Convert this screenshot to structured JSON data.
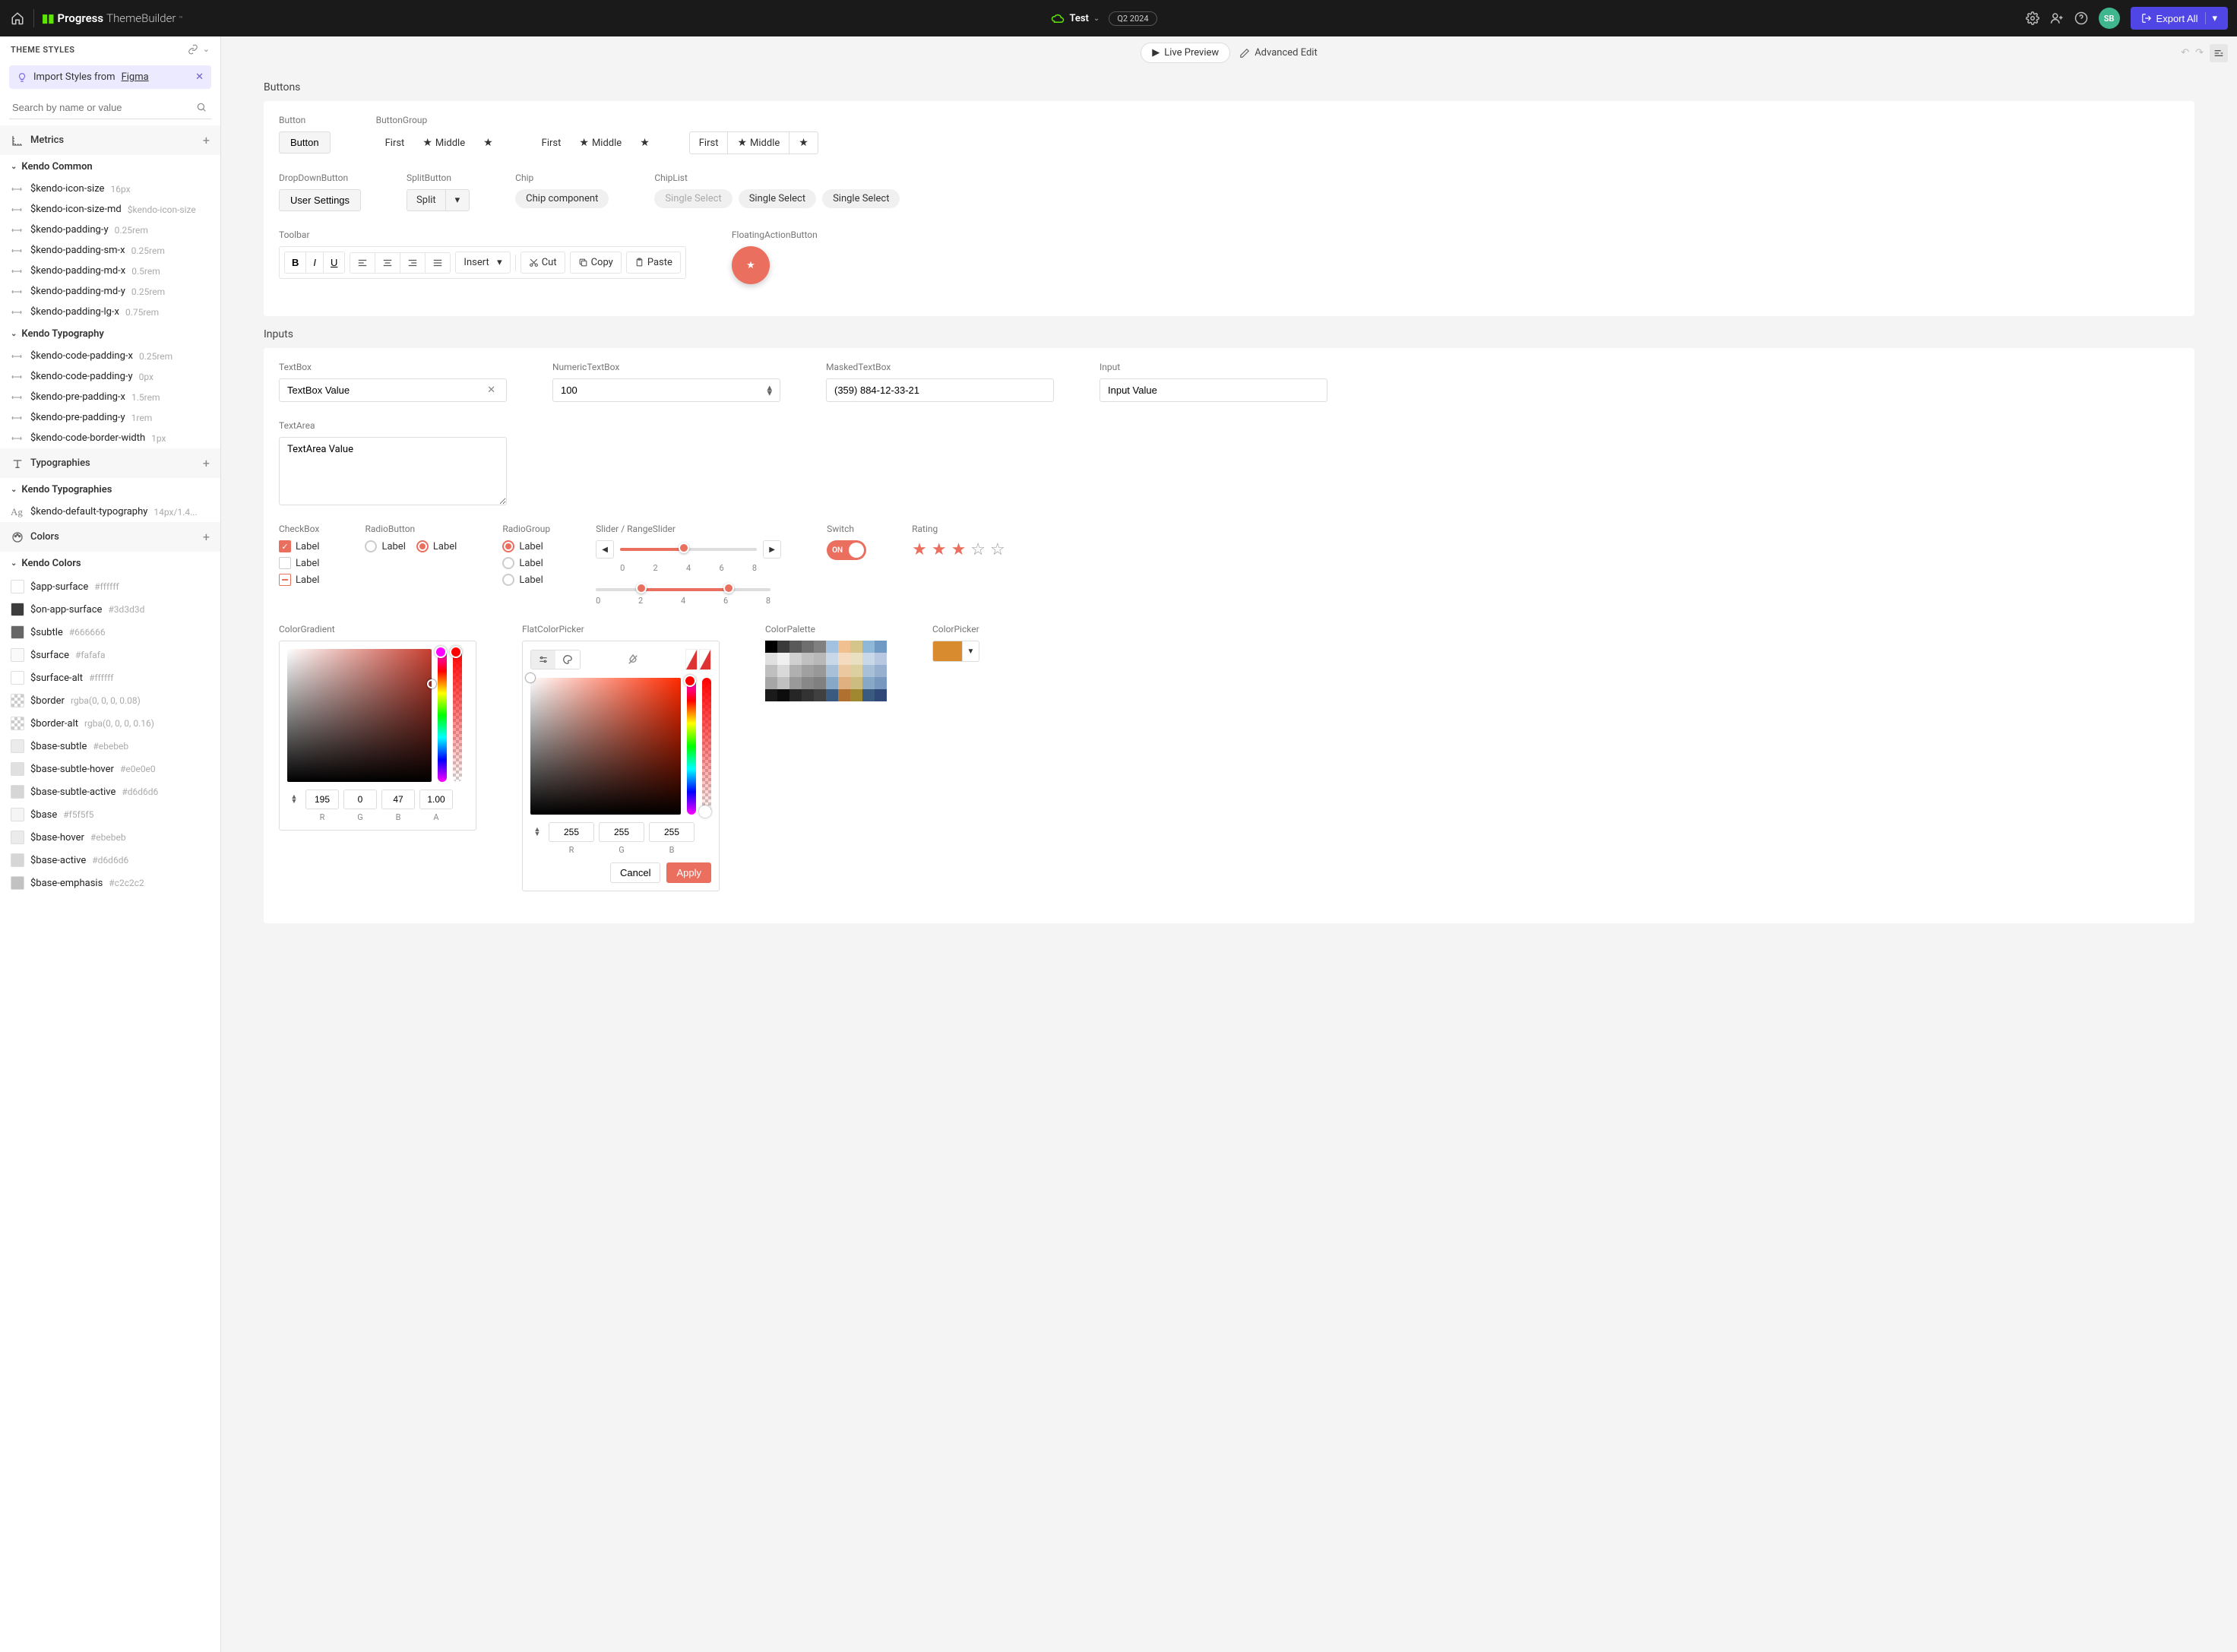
{
  "header": {
    "brand_primary": "Progress",
    "brand_secondary": "ThemeBuilder",
    "project": "Test",
    "badge": "Q2 2024",
    "avatar": "SB",
    "export": "Export All"
  },
  "topbar": {
    "live_preview": "Live Preview",
    "advanced_edit": "Advanced Edit"
  },
  "sidebar": {
    "title": "THEME STYLES",
    "figma_text": "Import Styles from ",
    "figma_link": "Figma",
    "search_placeholder": "Search by name or value",
    "cat_metrics": "Metrics",
    "cat_typo": "Typographies",
    "cat_colors": "Colors",
    "group_common": "Kendo Common",
    "group_typo": "Kendo Typography",
    "group_typos": "Kendo Typographies",
    "group_colors": "Kendo Colors",
    "common_vars": [
      {
        "name": "$kendo-icon-size",
        "val": "16px"
      },
      {
        "name": "$kendo-icon-size-md",
        "val": "$kendo-icon-size"
      },
      {
        "name": "$kendo-padding-y",
        "val": "0.25rem"
      },
      {
        "name": "$kendo-padding-sm-x",
        "val": "0.25rem"
      },
      {
        "name": "$kendo-padding-md-x",
        "val": "0.5rem"
      },
      {
        "name": "$kendo-padding-md-y",
        "val": "0.25rem"
      },
      {
        "name": "$kendo-padding-lg-x",
        "val": "0.75rem"
      }
    ],
    "typo_vars": [
      {
        "name": "$kendo-code-padding-x",
        "val": "0.25rem"
      },
      {
        "name": "$kendo-code-padding-y",
        "val": "0px"
      },
      {
        "name": "$kendo-pre-padding-x",
        "val": "1.5rem"
      },
      {
        "name": "$kendo-pre-padding-y",
        "val": "1rem"
      },
      {
        "name": "$kendo-code-border-width",
        "val": "1px"
      }
    ],
    "typographies": [
      {
        "name": "$kendo-default-typography",
        "val": "14px/1.4..."
      }
    ],
    "colors": [
      {
        "name": "$app-surface",
        "val": "#ffffff",
        "c": "#ffffff"
      },
      {
        "name": "$on-app-surface",
        "val": "#3d3d3d",
        "c": "#3d3d3d"
      },
      {
        "name": "$subtle",
        "val": "#666666",
        "c": "#666666"
      },
      {
        "name": "$surface",
        "val": "#fafafa",
        "c": "#fafafa"
      },
      {
        "name": "$surface-alt",
        "val": "#ffffff",
        "c": "#ffffff"
      },
      {
        "name": "$border",
        "val": "rgba(0, 0, 0, 0.08)",
        "c": "checker"
      },
      {
        "name": "$border-alt",
        "val": "rgba(0, 0, 0, 0.16)",
        "c": "checker"
      },
      {
        "name": "$base-subtle",
        "val": "#ebebeb",
        "c": "#ebebeb"
      },
      {
        "name": "$base-subtle-hover",
        "val": "#e0e0e0",
        "c": "#e0e0e0"
      },
      {
        "name": "$base-subtle-active",
        "val": "#d6d6d6",
        "c": "#d6d6d6"
      },
      {
        "name": "$base",
        "val": "#f5f5f5",
        "c": "#f5f5f5"
      },
      {
        "name": "$base-hover",
        "val": "#ebebeb",
        "c": "#ebebeb"
      },
      {
        "name": "$base-active",
        "val": "#d6d6d6",
        "c": "#d6d6d6"
      },
      {
        "name": "$base-emphasis",
        "val": "#c2c2c2",
        "c": "#c2c2c2"
      }
    ]
  },
  "buttons": {
    "section": "Buttons",
    "button_label": "Button",
    "button_text": "Button",
    "group_label": "ButtonGroup",
    "first": "First",
    "middle": "Middle",
    "dropdown_label": "DropDownButton",
    "dropdown_text": "User Settings",
    "split_label": "SplitButton",
    "split_text": "Split",
    "chip_label": "Chip",
    "chip_text": "Chip component",
    "chiplist_label": "ChipList",
    "chiplist_items": [
      "Single Select",
      "Single Select",
      "Single Select"
    ],
    "toolbar_label": "Toolbar",
    "insert": "Insert",
    "cut": "Cut",
    "copy": "Copy",
    "paste": "Paste",
    "fab_label": "FloatingActionButton"
  },
  "inputs": {
    "section": "Inputs",
    "textbox_label": "TextBox",
    "textbox_value": "TextBox Value",
    "numeric_label": "NumericTextBox",
    "numeric_value": "100",
    "masked_label": "MaskedTextBox",
    "masked_value": "(359) 884-12-33-21",
    "input_label": "Input",
    "input_value": "Input Value",
    "textarea_label": "TextArea",
    "textarea_value": "TextArea Value",
    "checkbox_label": "CheckBox",
    "radio_label": "RadioButton",
    "radiogroup_label": "RadioGroup",
    "label_text": "Label",
    "slider_label": "Slider / RangeSlider",
    "slider_ticks": [
      "0",
      "2",
      "4",
      "6",
      "8"
    ],
    "range_ticks": [
      "0",
      "2",
      "4",
      "6",
      "8"
    ],
    "switch_label": "Switch",
    "switch_on": "ON",
    "rating_label": "Rating",
    "colorgrad_label": "ColorGradient",
    "flat_label": "FlatColorPicker",
    "palette_label": "ColorPalette",
    "picker_label": "ColorPicker",
    "rgba": {
      "r": "195",
      "g": "0",
      "b": "47",
      "a": "1.00",
      "lr": "R",
      "lg": "G",
      "lb": "B",
      "la": "A"
    },
    "flat_rgb": {
      "r": "255",
      "g": "255",
      "b": "255",
      "lr": "R",
      "lg": "G",
      "lb": "B"
    },
    "cancel": "Cancel",
    "apply": "Apply"
  },
  "palette_colors": [
    "#000000",
    "#3a3a3a",
    "#595959",
    "#6e6e6e",
    "#808080",
    "#a3c1e0",
    "#f0c090",
    "#d6c58b",
    "#8fb8d8",
    "#7099c4",
    "#e0e0e0",
    "#f0f0f0",
    "#d0d0d0",
    "#c0c0c0",
    "#b8b8b8",
    "#c8d8e8",
    "#f5dcc0",
    "#e8e0c0",
    "#c8d8e8",
    "#b8c8e0",
    "#bfbfbf",
    "#d9d9d9",
    "#b0b0b0",
    "#a0a0a0",
    "#989898",
    "#a8c0d8",
    "#ecc8a0",
    "#dcd0a0",
    "#a8c0d8",
    "#98b0d0",
    "#a6a6a6",
    "#c0c0c0",
    "#999999",
    "#888888",
    "#808080",
    "#88a8c8",
    "#e0b080",
    "#ccbc80",
    "#88a8c8",
    "#7898c0",
    "#1a1a1a",
    "#0d0d0d",
    "#262626",
    "#333333",
    "#404040",
    "#3a5a80",
    "#b07030",
    "#a08830",
    "#3a5a80",
    "#304878"
  ]
}
